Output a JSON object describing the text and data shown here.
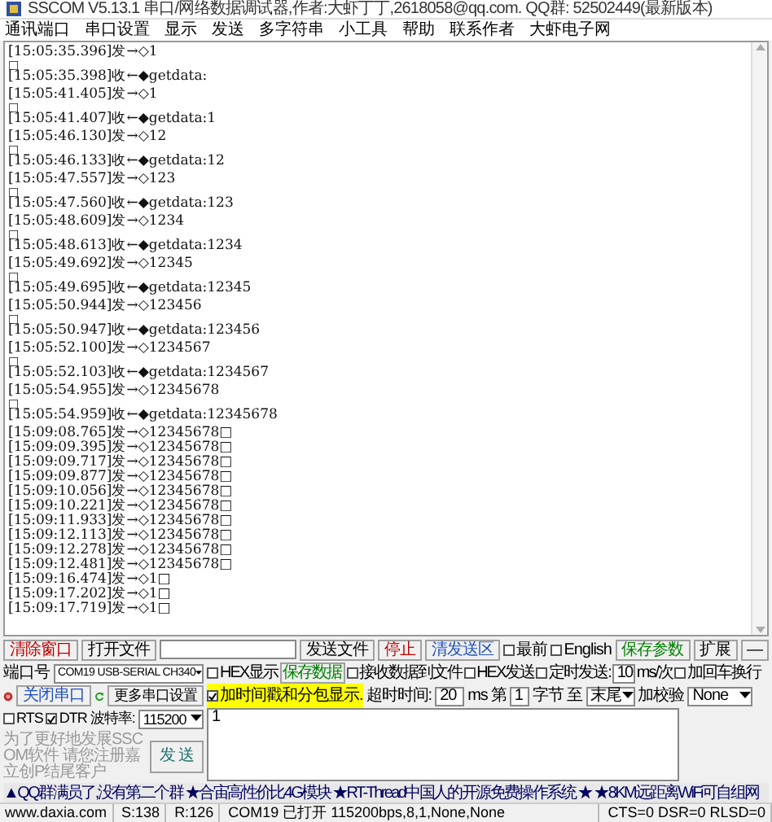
{
  "window": {
    "title": "SSCOM V5.13.1 串口/网络数据调试器,作者:大虾丁丁,2618058@qq.com. QQ群: 52502449(最新版本)"
  },
  "menu": [
    "通讯端口",
    "串口设置",
    "显示",
    "发送",
    "多字符串",
    "小工具",
    "帮助",
    "联系作者",
    "大虾电子网"
  ],
  "log": [
    {
      "kind": "line",
      "text": "[15:05:35.396]发→◇1"
    },
    {
      "kind": "mark",
      "text": "□"
    },
    {
      "kind": "line",
      "text": "[15:05:35.398]收←◆getdata:"
    },
    {
      "kind": "gap"
    },
    {
      "kind": "line",
      "text": "[15:05:41.405]发→◇1"
    },
    {
      "kind": "mark",
      "text": "□"
    },
    {
      "kind": "line",
      "text": "[15:05:41.407]收←◆getdata:1"
    },
    {
      "kind": "gap"
    },
    {
      "kind": "line",
      "text": "[15:05:46.130]发→◇12"
    },
    {
      "kind": "mark",
      "text": "□"
    },
    {
      "kind": "line",
      "text": "[15:05:46.133]收←◆getdata:12"
    },
    {
      "kind": "gap"
    },
    {
      "kind": "line",
      "text": "[15:05:47.557]发→◇123"
    },
    {
      "kind": "mark",
      "text": "□"
    },
    {
      "kind": "line",
      "text": "[15:05:47.560]收←◆getdata:123"
    },
    {
      "kind": "gap"
    },
    {
      "kind": "line",
      "text": "[15:05:48.609]发→◇1234"
    },
    {
      "kind": "mark",
      "text": "□"
    },
    {
      "kind": "line",
      "text": "[15:05:48.613]收←◆getdata:1234"
    },
    {
      "kind": "gap"
    },
    {
      "kind": "line",
      "text": "[15:05:49.692]发→◇12345"
    },
    {
      "kind": "mark",
      "text": "□"
    },
    {
      "kind": "line",
      "text": "[15:05:49.695]收←◆getdata:12345"
    },
    {
      "kind": "gap"
    },
    {
      "kind": "line",
      "text": "[15:05:50.944]发→◇123456"
    },
    {
      "kind": "mark",
      "text": "□"
    },
    {
      "kind": "line",
      "text": "[15:05:50.947]收←◆getdata:123456"
    },
    {
      "kind": "gap"
    },
    {
      "kind": "line",
      "text": "[15:05:52.100]发→◇1234567"
    },
    {
      "kind": "mark",
      "text": "□"
    },
    {
      "kind": "line",
      "text": "[15:05:52.103]收←◆getdata:1234567"
    },
    {
      "kind": "gap"
    },
    {
      "kind": "line",
      "text": "[15:05:54.955]发→◇12345678"
    },
    {
      "kind": "mark",
      "text": "□"
    },
    {
      "kind": "line",
      "text": "[15:05:54.959]收←◆getdata:12345678"
    },
    {
      "kind": "gap"
    },
    {
      "kind": "line",
      "text": "[15:09:08.765]发→◇12345678□"
    },
    {
      "kind": "line",
      "text": "[15:09:09.395]发→◇12345678□"
    },
    {
      "kind": "line",
      "text": "[15:09:09.717]发→◇12345678□"
    },
    {
      "kind": "line",
      "text": "[15:09:09.877]发→◇12345678□"
    },
    {
      "kind": "line",
      "text": "[15:09:10.056]发→◇12345678□"
    },
    {
      "kind": "line",
      "text": "[15:09:10.221]发→◇12345678□"
    },
    {
      "kind": "line",
      "text": "[15:09:11.933]发→◇12345678□"
    },
    {
      "kind": "line",
      "text": "[15:09:12.113]发→◇12345678□"
    },
    {
      "kind": "line",
      "text": "[15:09:12.278]发→◇12345678□"
    },
    {
      "kind": "line",
      "text": "[15:09:12.481]发→◇12345678□"
    },
    {
      "kind": "line",
      "text": "[15:09:16.474]发→◇1□"
    },
    {
      "kind": "line",
      "text": "[15:09:17.202]发→◇1□"
    },
    {
      "kind": "line",
      "text": "[15:09:17.719]发→◇1□"
    }
  ],
  "toolbar": {
    "clear_button": "清除窗口",
    "open_file_button": "打开文件",
    "send_file_button": "发送文件",
    "stop_button": "停止",
    "clear_send_button": "清发送区",
    "topmost": {
      "label": "最前",
      "checked": false
    },
    "english": {
      "label": "English",
      "checked": false
    },
    "save_params_button": "保存参数",
    "expand_button": "扩展",
    "collapse_button": "—"
  },
  "port": {
    "label": "端口号",
    "value": "COM19 USB-SERIAL CH340",
    "close_button": "关闭串口",
    "more_settings_button": "更多串口设置",
    "rts": {
      "label": "RTS",
      "checked": false
    },
    "dtr": {
      "label": "DTR",
      "checked": true
    },
    "baud_label": "波特率:",
    "baud": "115200",
    "notice": "为了更好地发展SSCOM软件 请您注册嘉立创P结尾客户",
    "send_button": "发 送"
  },
  "options": {
    "hex_display": {
      "label": "HEX显示",
      "checked": false
    },
    "save_data_button": "保存数据",
    "recv_to_file": {
      "label": "接收数据到文件",
      "checked": false
    },
    "hex_send": {
      "label": "HEX发送",
      "checked": false
    },
    "timed_send": {
      "label": "定时发送:",
      "checked": false
    },
    "interval": "10",
    "interval_unit": "ms/次",
    "add_crlf": {
      "label": "加回车换行",
      "checked": false
    },
    "timestamp": {
      "label": "加时间戳和分包显示.",
      "checked": true
    },
    "timeout_label": "超时时间:",
    "timeout": "20",
    "timeout_unit": "ms",
    "byte_from_label": "第",
    "byte_from": "1",
    "byte_to_label": "字节 至",
    "byte_to": "末尾",
    "checksum_label": "加校验",
    "checksum": "None"
  },
  "send_text": "1",
  "ticker": "▲QQ群满员了,没有第二个群 ★合宙高性价比4G模块 ★RT-Thread中国人的开源免费操作系统 ★ ★8KM远距离WiFi可自组网",
  "status_bar": [
    "www.daxia.com",
    "S:138",
    "R:126",
    "COM19 已打开  115200bps,8,1,None,None",
    "CTS=0 DSR=0 RLSD=0"
  ]
}
